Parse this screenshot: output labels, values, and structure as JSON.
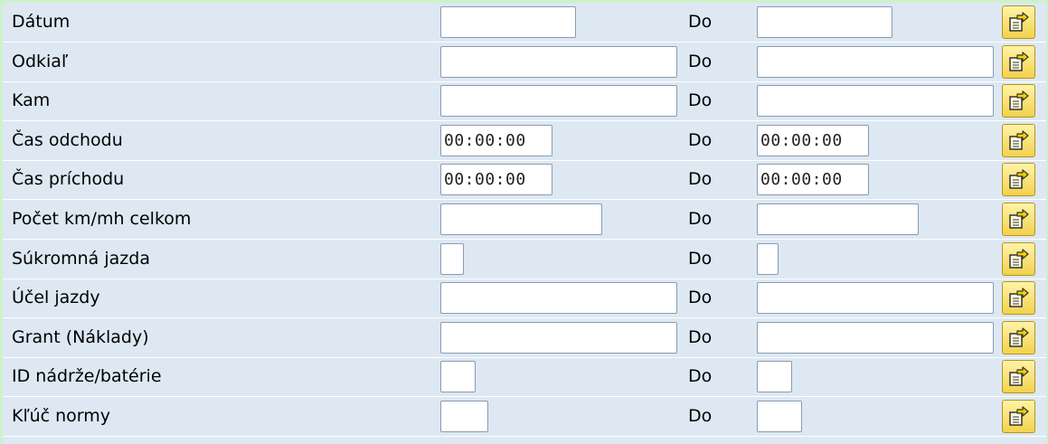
{
  "form": {
    "to_label": "Do",
    "rows": [
      {
        "label": "Dátum",
        "from_value": "",
        "to_value": ""
      },
      {
        "label": "Odkiaľ",
        "from_value": "",
        "to_value": ""
      },
      {
        "label": "Kam",
        "from_value": "",
        "to_value": ""
      },
      {
        "label": "Čas odchodu",
        "from_value": "00:00:00",
        "to_value": "00:00:00"
      },
      {
        "label": "Čas príchodu",
        "from_value": "00:00:00",
        "to_value": "00:00:00"
      },
      {
        "label": "Počet km/mh celkom",
        "from_value": "",
        "to_value": ""
      },
      {
        "label": "Súkromná jazda",
        "from_value": "",
        "to_value": ""
      },
      {
        "label": "Účel jazdy",
        "from_value": "",
        "to_value": ""
      },
      {
        "label": "Grant (Náklady)",
        "from_value": "",
        "to_value": ""
      },
      {
        "label": "ID nádrže/batérie",
        "from_value": "",
        "to_value": ""
      },
      {
        "label": "Kľúč normy",
        "from_value": "",
        "to_value": ""
      }
    ],
    "multiple_selection_icon": "multiple-selection-arrow-icon"
  }
}
